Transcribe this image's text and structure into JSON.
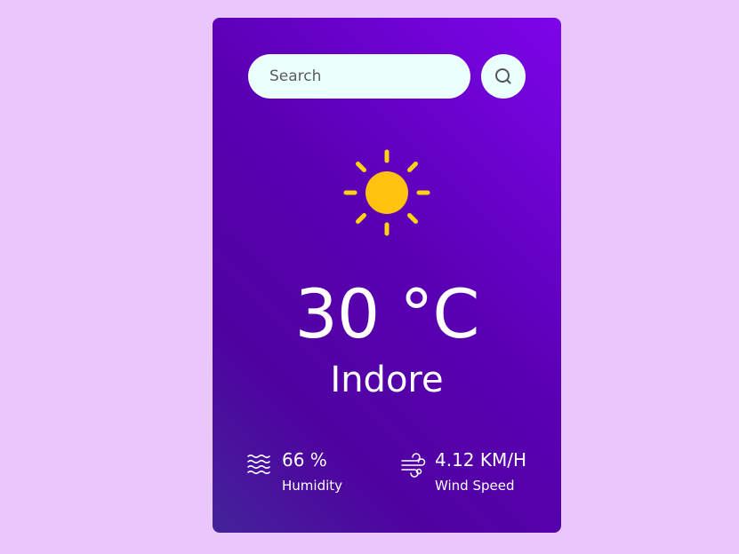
{
  "search": {
    "placeholder": "Search",
    "value": "",
    "button_icon": "search-icon"
  },
  "weather": {
    "icon": "sun-icon",
    "temperature": "30 °C",
    "city": "Indore"
  },
  "details": {
    "humidity": {
      "icon": "humidity-icon",
      "value": "66 %",
      "label": "Humidity"
    },
    "wind": {
      "icon": "wind-icon",
      "value": "4.12 KM/H",
      "label": "Wind Speed"
    }
  },
  "colors": {
    "page_background": "#e9c6fb",
    "card_gradient_start": "#7d05ea",
    "card_gradient_end": "#432399",
    "input_background": "#ebfffc",
    "sun": "#ffc20e",
    "text": "#ffffff"
  }
}
